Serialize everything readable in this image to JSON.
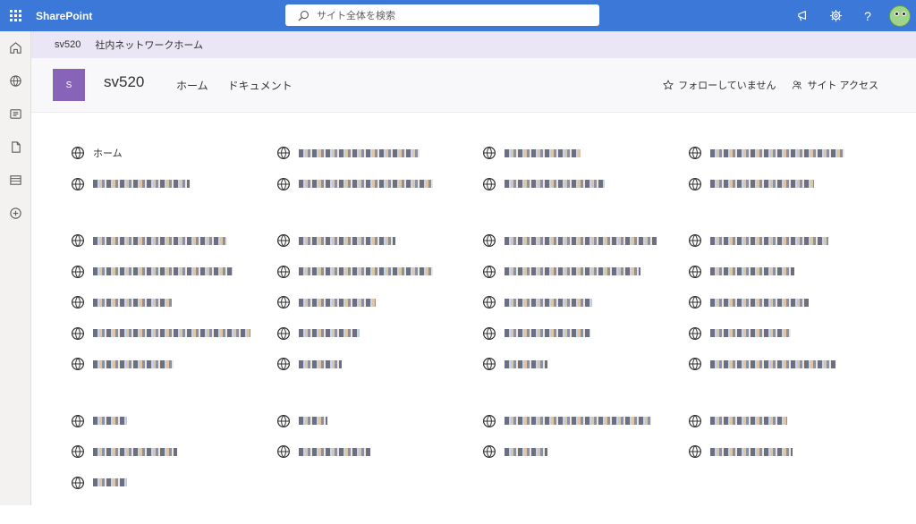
{
  "suite": {
    "brand": "SharePoint",
    "search_placeholder": "サイト全体を検索",
    "help_label": "?"
  },
  "hub": {
    "site_name": "sv520",
    "hub_name": "社内ネットワークホーム"
  },
  "site": {
    "logo_letter": "S",
    "title": "sv520",
    "nav": [
      "ホーム",
      "ドキュメント"
    ],
    "follow_label": "フォローしていません",
    "access_label": "サイト アクセス"
  },
  "links": {
    "home_label": "ホーム"
  },
  "colors": {
    "suitebar": "#3c78d8",
    "hubbar": "#ebe6f5",
    "site_logo": "#8764b8"
  }
}
